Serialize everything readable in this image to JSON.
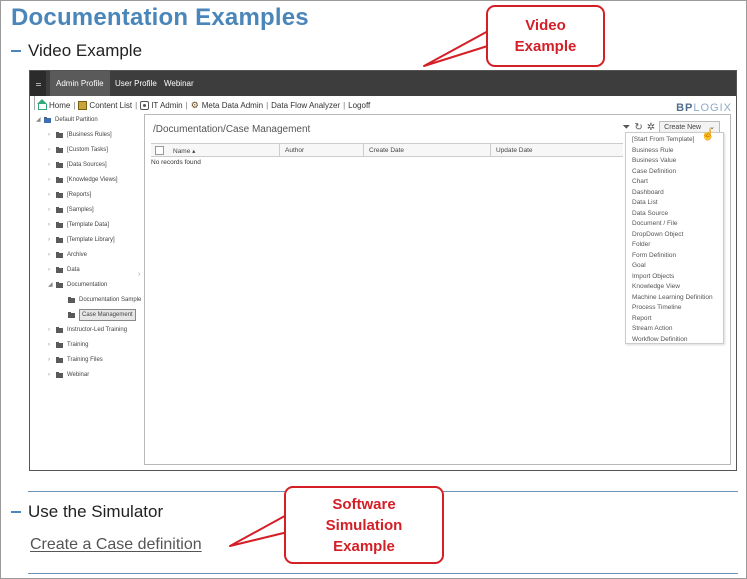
{
  "doc": {
    "title": "Documentation Examples",
    "video_section": "Video Example",
    "simulator_section": "Use the Simulator",
    "simulator_link": "Create a Case definition"
  },
  "callouts": {
    "video_line1": "Video",
    "video_line2": "Example",
    "sim_line1": "Software",
    "sim_line2": "Simulation",
    "sim_line3": "Example"
  },
  "app": {
    "tabs": [
      "Admin Profile",
      "User Profile",
      "Webinar"
    ],
    "nav": [
      "Home",
      "Content List",
      "IT Admin",
      "Meta Data Admin",
      "Data Flow Analyzer",
      "Logoff"
    ],
    "brand_bold": "BP",
    "brand_light": "LOGIX",
    "tree": {
      "root": "Default Partition",
      "folders": [
        "[Business Rules]",
        "[Custom Tasks]",
        "[Data Sources]",
        "[Knowledge Views]",
        "[Reports]",
        "[Samples]",
        "[Template Data]",
        "[Template Library]",
        "Archive",
        "Data",
        "Documentation"
      ],
      "documentation_children": [
        "Documentation Sample",
        "Case Management"
      ],
      "folders_after": [
        "Instructor-Led Training",
        "Training",
        "Training Files",
        "Webinar"
      ]
    },
    "main": {
      "path": "/Documentation/Case Management",
      "create_new": "Create New",
      "columns": [
        "Name",
        "Author",
        "Create Date",
        "Update Date"
      ],
      "empty_text": "No records found",
      "menu_items": [
        "[Start From Template]",
        "Business Rule",
        "Business Value",
        "Case Definition",
        "Chart",
        "Dashboard",
        "Data List",
        "Data Source",
        "Document / File",
        "DropDown Object",
        "Folder",
        "Form Definition",
        "Goal",
        "Import Objects",
        "Knowledge View",
        "Machine Learning Definition",
        "Process Timeline",
        "Report",
        "Stream Action",
        "Workflow Definition"
      ]
    }
  },
  "colors": {
    "title_blue": "#4a86b9",
    "callout_red": "#d41f26",
    "app_bar": "#3d3d3d"
  }
}
